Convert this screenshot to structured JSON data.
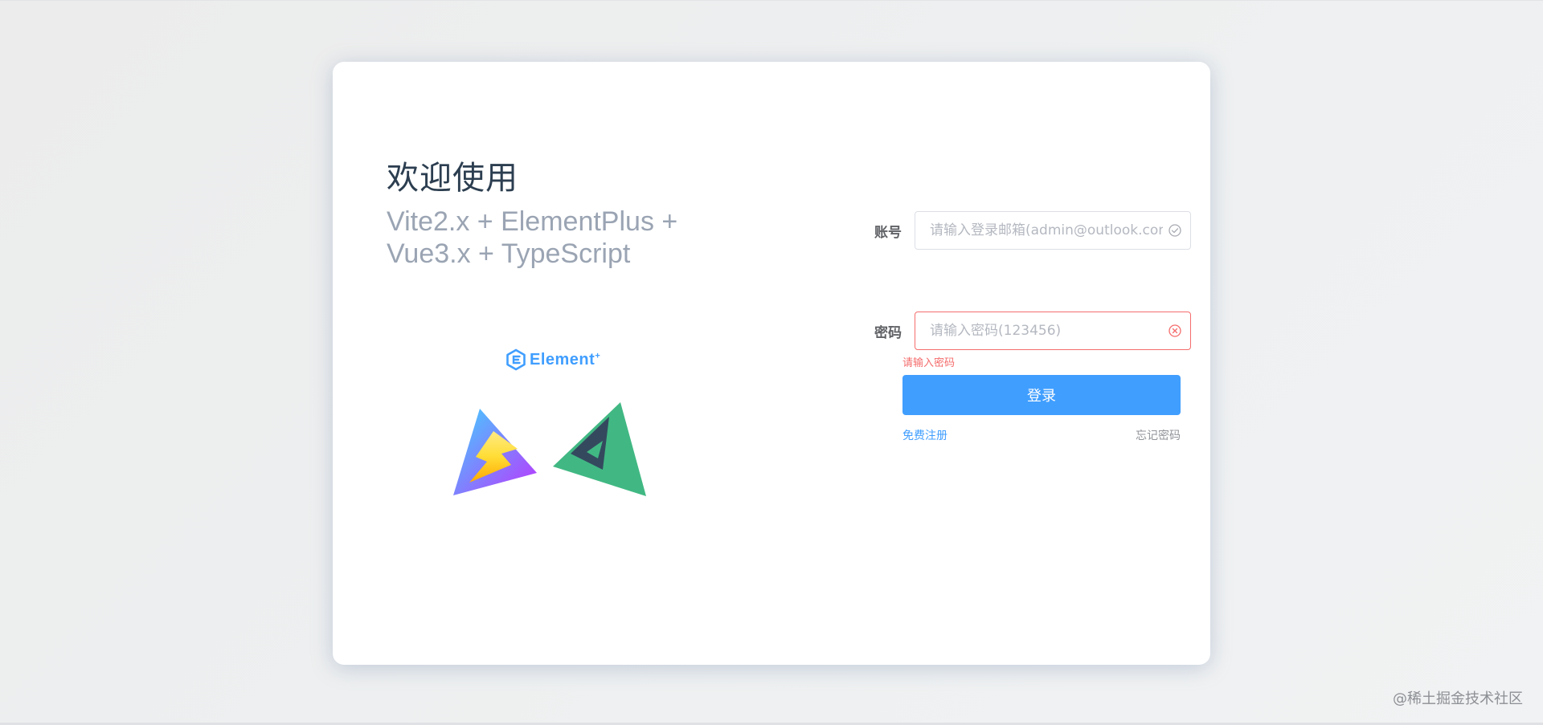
{
  "welcome": {
    "title": "欢迎使用",
    "subtitle": "Vite2.x + ElementPlus + Vue3.x + TypeScript"
  },
  "logos": {
    "element_text": "Element",
    "element_sup": "+",
    "icons": [
      "element-plus-logo",
      "vite-logo",
      "vue-logo"
    ]
  },
  "form": {
    "account": {
      "label": "账号",
      "value": "",
      "placeholder": "请输入登录邮箱(admin@outlook.com)",
      "suffix_icon": "circle-check-icon"
    },
    "password": {
      "label": "密码",
      "value": "",
      "placeholder": "请输入密码(123456)",
      "suffix_icon": "circle-close-icon",
      "error": "请输入密码"
    },
    "submit_label": "登录",
    "register_link": "免费注册",
    "forgot_link": "忘记密码"
  },
  "watermark": "@稀土掘金技术社区",
  "colors": {
    "primary": "#409eff",
    "danger": "#f56c6c",
    "title": "#2c3e50",
    "subtitle": "#9aa4b3",
    "label": "#606266"
  }
}
